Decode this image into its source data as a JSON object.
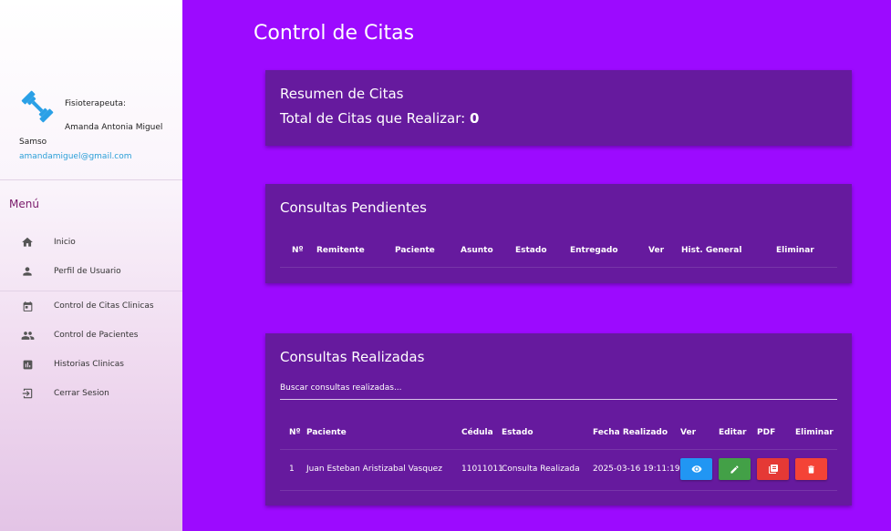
{
  "sidebar": {
    "role": "Fisioterapeuta:",
    "name_line1": "Amanda Antonia Miguel",
    "name_line2": "Samso",
    "email": "amandamiguel@gmail.com",
    "menu_title": "Menú",
    "items": [
      {
        "label": "Inicio",
        "icon": "home-icon"
      },
      {
        "label": "Perfil de Usuario",
        "icon": "person-icon"
      },
      {
        "label": "Control de Citas Clinicas",
        "icon": "calendar-icon"
      },
      {
        "label": "Control de Pacientes",
        "icon": "people-icon"
      },
      {
        "label": "Historias Clinicas",
        "icon": "chart-icon"
      },
      {
        "label": "Cerrar Sesion",
        "icon": "logout-icon"
      }
    ]
  },
  "page": {
    "title": "Control de Citas"
  },
  "summary": {
    "title": "Resumen de Citas",
    "total_label": "Total de Citas que Realizar:",
    "total_value": "0"
  },
  "pending": {
    "title": "Consultas Pendientes",
    "headers": [
      "Nº",
      "Remitente",
      "Paciente",
      "Asunto",
      "Estado",
      "Entregado",
      "Ver",
      "Hist. General",
      "Eliminar"
    ]
  },
  "done": {
    "title": "Consultas Realizadas",
    "search_placeholder": "Buscar consultas realizadas...",
    "headers": [
      "Nº",
      "Paciente",
      "Cédula",
      "Estado",
      "Fecha Realizado",
      "Ver",
      "Editar",
      "PDF",
      "Eliminar"
    ],
    "rows": [
      {
        "n": "1",
        "paciente": "Juan Esteban Aristizabal Vasquez",
        "cedula": "11011011",
        "estado": "Consulta Realizada",
        "fecha": "2025-03-16 19:11:19"
      }
    ]
  },
  "colors": {
    "background": "#9c0aff",
    "card": "#661a9e",
    "view_button": "#2196f3",
    "edit_button": "#43a047",
    "pdf_button": "#e53935",
    "delete_button": "#f44336",
    "logo": "#2aa0e6"
  }
}
